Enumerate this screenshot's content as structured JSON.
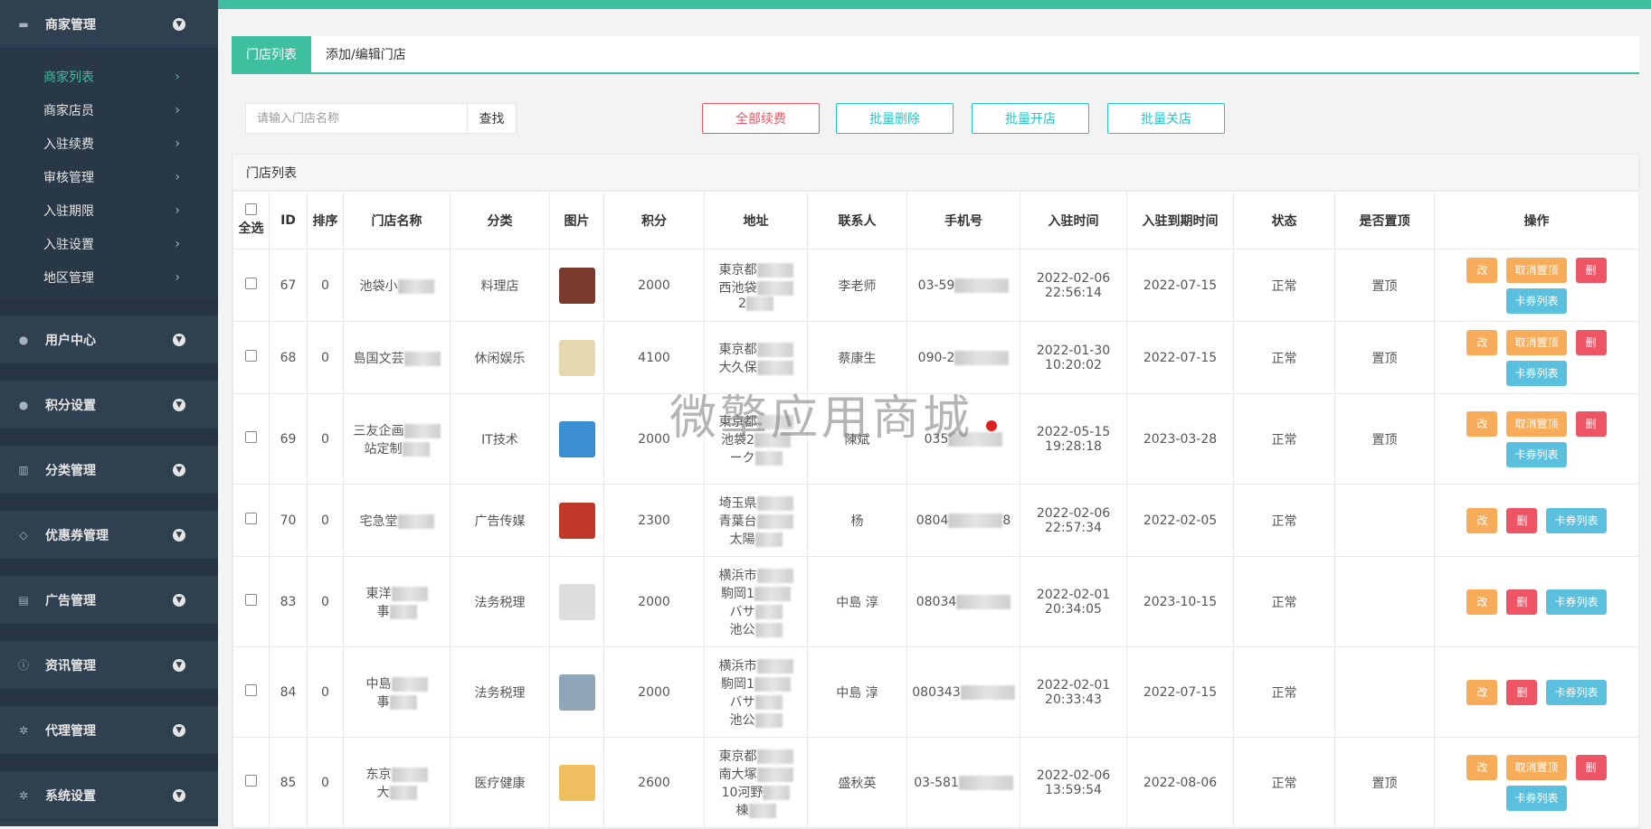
{
  "sidebar": {
    "groups": [
      {
        "label": "商家管理",
        "icon": "bed-icon"
      },
      {
        "label": "用户中心",
        "icon": "user-icon"
      },
      {
        "label": "积分设置",
        "icon": "user-icon"
      },
      {
        "label": "分类管理",
        "icon": "chart-icon"
      },
      {
        "label": "优惠券管理",
        "icon": "diamond-icon"
      },
      {
        "label": "广告管理",
        "icon": "bank-icon"
      },
      {
        "label": "资讯管理",
        "icon": "info-icon"
      },
      {
        "label": "代理管理",
        "icon": "gear-icon"
      },
      {
        "label": "系统设置",
        "icon": "gear-icon"
      }
    ],
    "sub_items": [
      {
        "label": "商家列表",
        "arrow": "›"
      },
      {
        "label": "商家店员",
        "arrow": "›"
      },
      {
        "label": "入驻续费",
        "arrow": "›"
      },
      {
        "label": "审核管理",
        "arrow": "›"
      },
      {
        "label": "入驻期限",
        "arrow": "›"
      },
      {
        "label": "入驻设置",
        "arrow": "›"
      },
      {
        "label": "地区管理",
        "arrow": "›"
      }
    ]
  },
  "tabs": {
    "list": "门店列表",
    "edit": "添加/编辑门店"
  },
  "search": {
    "placeholder": "请输入门店名称",
    "button": "查找"
  },
  "bulk": {
    "renew": "全部续费",
    "delete": "批量删除",
    "open": "批量开店",
    "close": "批量关店"
  },
  "panel": {
    "title": "门店列表"
  },
  "table": {
    "headers": {
      "select_all": "全选",
      "id": "ID",
      "sort": "排序",
      "name": "门店名称",
      "category": "分类",
      "image": "图片",
      "points": "积分",
      "address": "地址",
      "contact": "联系人",
      "phone": "手机号",
      "join_time": "入驻时间",
      "expire_time": "入驻到期时间",
      "status": "状态",
      "pinned": "是否置顶",
      "actions": "操作"
    },
    "actions": {
      "edit": "改",
      "unpin": "取消置顶",
      "delete": "删",
      "coupons": "卡券列表"
    },
    "rows": [
      {
        "id": "67",
        "sort": "0",
        "name": "池袋小",
        "category": "料理店",
        "points": "2000",
        "addr1": "東京都",
        "addr2": "西池袋",
        "addr3": "2",
        "contact": "李老师",
        "phone": "03-59",
        "join_date": "2022-02-06",
        "join_time": "22:56:14",
        "expire": "2022-07-15",
        "status": "正常",
        "pinned": "置顶",
        "has_unpin": true,
        "thumb_color": "#7a3b2e"
      },
      {
        "id": "68",
        "sort": "0",
        "name": "島国文芸",
        "category": "休闲娱乐",
        "points": "4100",
        "addr1": "東京都",
        "addr2": "大久保",
        "addr3": "",
        "contact": "蔡康生",
        "phone": "090-2",
        "join_date": "2022-01-30",
        "join_time": "10:20:02",
        "expire": "2022-07-15",
        "status": "正常",
        "pinned": "置顶",
        "has_unpin": true,
        "thumb_color": "#e8d8b0"
      },
      {
        "id": "69",
        "sort": "0",
        "name": "三友企画",
        "name2": "站定制",
        "category": "IT技术",
        "points": "2000",
        "addr1": "東京都",
        "addr2": "池袋2",
        "addr3": "ーク",
        "contact": "陳斌",
        "phone": "035",
        "join_date": "2022-05-15",
        "join_time": "19:28:18",
        "expire": "2023-03-28",
        "status": "正常",
        "pinned": "置顶",
        "has_unpin": true,
        "thumb_color": "#3a8fd0"
      },
      {
        "id": "70",
        "sort": "0",
        "name": "宅急堂",
        "category": "广告传媒",
        "points": "2300",
        "addr1": "埼玉県",
        "addr2": "青葉台",
        "addr3": "太陽",
        "contact": "杨",
        "phone": "0804",
        "phone_tail": "8",
        "join_date": "2022-02-06",
        "join_time": "22:57:34",
        "expire": "2022-02-05",
        "status": "正常",
        "pinned": "",
        "has_unpin": false,
        "thumb_color": "#c0392b"
      },
      {
        "id": "83",
        "sort": "0",
        "name": "東洋",
        "name2": "事",
        "category": "法务税理",
        "points": "2000",
        "addr1": "横浜市",
        "addr2": "駒岡1",
        "addr3": "バサ",
        "addr4": "池公",
        "contact": "中島 淳",
        "phone": "08034",
        "join_date": "2022-02-01",
        "join_time": "20:34:05",
        "expire": "2023-10-15",
        "status": "正常",
        "pinned": "",
        "has_unpin": false,
        "thumb_color": "#dddddd"
      },
      {
        "id": "84",
        "sort": "0",
        "name": "中島",
        "name2": "事",
        "category": "法务税理",
        "points": "2000",
        "addr1": "横浜市",
        "addr2": "駒岡1",
        "addr3": "バサ",
        "addr4": "池公",
        "contact": "中島 淳",
        "phone": "080343",
        "join_date": "2022-02-01",
        "join_time": "20:33:43",
        "expire": "2022-07-15",
        "status": "正常",
        "pinned": "",
        "has_unpin": false,
        "thumb_color": "#8fa6b8"
      },
      {
        "id": "85",
        "sort": "0",
        "name": "东京",
        "name2": "大",
        "category": "医疗健康",
        "points": "2600",
        "addr1": "東京都",
        "addr2": "南大塚",
        "addr3": "10河野",
        "addr4": "棟",
        "contact": "盛秋英",
        "phone": "03-581",
        "join_date": "2022-02-06",
        "join_time": "13:59:54",
        "expire": "2022-08-06",
        "status": "正常",
        "pinned": "置顶",
        "has_unpin": true,
        "thumb_color": "#f0c060"
      }
    ]
  },
  "watermark": "微擎应用商城"
}
